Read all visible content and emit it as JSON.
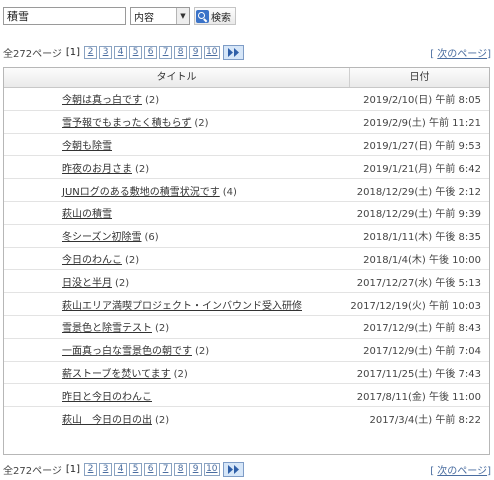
{
  "search": {
    "query": "積雪",
    "scope": "内容",
    "button_label": "検索"
  },
  "pager": {
    "total": "全272ページ",
    "current": "[1]",
    "pages": [
      "2",
      "3",
      "4",
      "5",
      "6",
      "7",
      "8",
      "9",
      "10"
    ],
    "next_label": "次のページ",
    "next_open": "[",
    "next_close": "]"
  },
  "table": {
    "columns": {
      "title": "タイトル",
      "date": "日付"
    },
    "rows": [
      {
        "title": "今朝は真っ白です",
        "count": "(2)",
        "date": "2019/2/10(日) 午前 8:05"
      },
      {
        "title": "雪予報でもまったく積もらず",
        "count": "(2)",
        "date": "2019/2/9(土) 午前 11:21"
      },
      {
        "title": "今朝も除雪",
        "count": "",
        "date": "2019/1/27(日) 午前 9:53"
      },
      {
        "title": "昨夜のお月さま",
        "count": "(2)",
        "date": "2019/1/21(月) 午前 6:42"
      },
      {
        "title": "JUNログのある敷地の積雪状況です",
        "count": "(4)",
        "date": "2018/12/29(土) 午後 2:12"
      },
      {
        "title": "萩山の積雪",
        "count": "",
        "date": "2018/12/29(土) 午前 9:39"
      },
      {
        "title": "冬シーズン初除雪",
        "count": "(6)",
        "date": "2018/1/11(木) 午後 8:35"
      },
      {
        "title": "今日のわんこ",
        "count": "(2)",
        "date": "2018/1/4(木) 午後 10:00"
      },
      {
        "title": "日没と半月",
        "count": "(2)",
        "date": "2017/12/27(水) 午後 5:13"
      },
      {
        "title": "萩山エリア満喫プロジェクト・インバウンド受入研修",
        "count": "",
        "date": "2017/12/19(火) 午前 10:03"
      },
      {
        "title": "雪景色と除雪テスト",
        "count": "(2)",
        "date": "2017/12/9(土) 午前 8:43"
      },
      {
        "title": "一面真っ白な雪景色の朝です",
        "count": "(2)",
        "date": "2017/12/9(土) 午前 7:04"
      },
      {
        "title": "薪ストーブを焚いてます",
        "count": "(2)",
        "date": "2017/11/25(土) 午後 7:43"
      },
      {
        "title": "昨日と今日のわんこ",
        "count": "",
        "date": "2017/8/11(金) 午後 11:00"
      },
      {
        "title": "萩山　今日の日の出",
        "count": "(2)",
        "date": "2017/3/4(土) 午前 8:22"
      }
    ]
  }
}
